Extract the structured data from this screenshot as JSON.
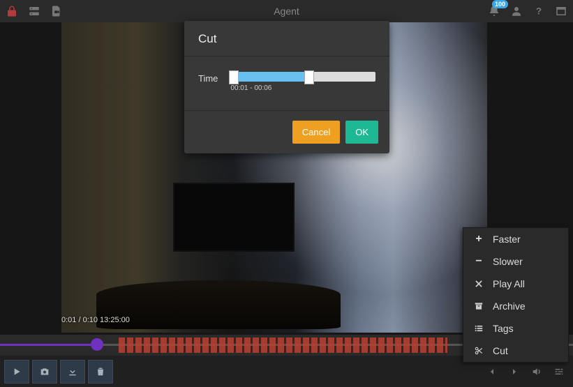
{
  "header": {
    "title": "Agent",
    "notification_count": "100"
  },
  "modal": {
    "title": "Cut",
    "time_label": "Time",
    "time_range": "00:01 - 00:06",
    "cancel_label": "Cancel",
    "ok_label": "OK"
  },
  "player": {
    "time_overlay": "0:01 / 0:10  13:25:00"
  },
  "context_menu": {
    "faster": "Faster",
    "slower": "Slower",
    "play_all": "Play All",
    "archive": "Archive",
    "tags": "Tags",
    "cut": "Cut"
  },
  "colors": {
    "accent_blue": "#68c0f0",
    "warning": "#f0a020",
    "success": "#1fb895",
    "timeline_progress": "#7030c0",
    "motion_bars": "#b84030"
  }
}
